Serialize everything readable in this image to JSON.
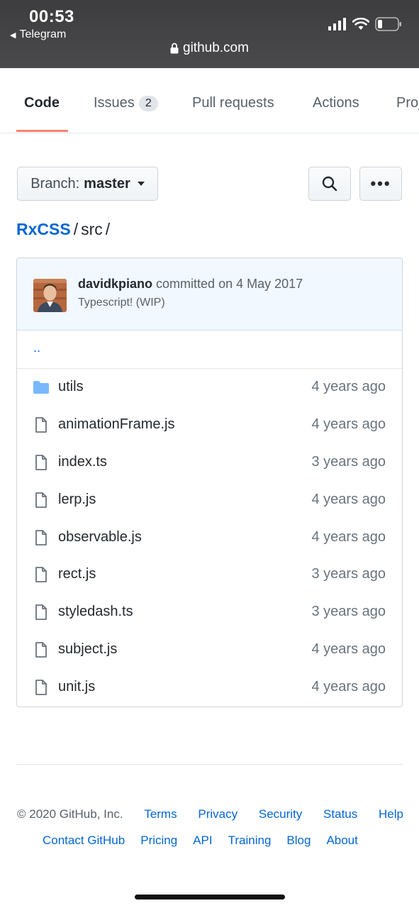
{
  "status": {
    "time": "00:53",
    "back_app": "Telegram",
    "url": "github.com"
  },
  "tabs": [
    {
      "label": "Code",
      "active": true
    },
    {
      "label": "Issues",
      "count": "2"
    },
    {
      "label": "Pull requests"
    },
    {
      "label": "Actions"
    },
    {
      "label": "Projects"
    }
  ],
  "toolbar": {
    "branch_prefix": "Branch:",
    "branch_name": "master",
    "more_label": "•••"
  },
  "breadcrumb": {
    "repo": "RxCSS",
    "dir": "src",
    "sep": "/"
  },
  "commit": {
    "author": "davidkpiano",
    "info": "committed on 4 May 2017",
    "message": "Typescript! (WIP)"
  },
  "updir": "..",
  "files": [
    {
      "name": "utils",
      "type": "folder",
      "age": "4 years ago"
    },
    {
      "name": "animationFrame.js",
      "type": "file",
      "age": "4 years ago"
    },
    {
      "name": "index.ts",
      "type": "file",
      "age": "3 years ago"
    },
    {
      "name": "lerp.js",
      "type": "file",
      "age": "4 years ago"
    },
    {
      "name": "observable.js",
      "type": "file",
      "age": "4 years ago"
    },
    {
      "name": "rect.js",
      "type": "file",
      "age": "3 years ago"
    },
    {
      "name": "styledash.ts",
      "type": "file",
      "age": "3 years ago"
    },
    {
      "name": "subject.js",
      "type": "file",
      "age": "4 years ago"
    },
    {
      "name": "unit.js",
      "type": "file",
      "age": "4 years ago"
    }
  ],
  "footer": {
    "copyright": "© 2020 GitHub, Inc.",
    "links1": [
      "Terms",
      "Privacy",
      "Security",
      "Status",
      "Help"
    ],
    "links2": [
      "Contact GitHub",
      "Pricing",
      "API",
      "Training",
      "Blog",
      "About"
    ]
  },
  "colors": {
    "link": "#0366d6",
    "tab_underline": "#f9826c",
    "folder": "#79b8ff",
    "commit_bg": "#f1f8ff"
  }
}
